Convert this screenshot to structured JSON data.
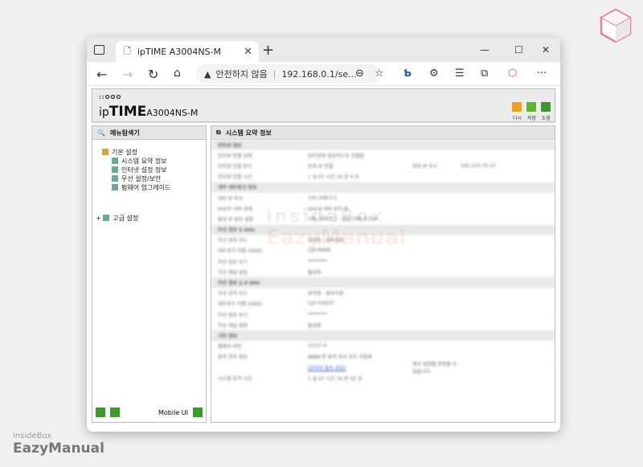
{
  "tab": {
    "title": "ipTIME A3004NS-M"
  },
  "address": {
    "security": "안전하지 않음",
    "url": "192.168.0.1/se..."
  },
  "router": {
    "dots": "::OOO",
    "logo_ip": "ip",
    "logo_time": "TIME",
    "model": "A3004NS-M",
    "buttons": [
      {
        "label": "다시",
        "color": "#f0a020"
      },
      {
        "label": "저장",
        "color": "#5ab82e"
      },
      {
        "label": "도움",
        "color": "#3a9b2a"
      }
    ]
  },
  "menu": {
    "title": "메뉴탐색기",
    "basic": "기본 설정",
    "items": [
      "시스템 요약 정보",
      "인터넷 설정 정보",
      "무선 설정/보안",
      "펌웨어 업그레이드"
    ],
    "advanced": "고급 설정",
    "mobile": "Mobile UI"
  },
  "info": {
    "title": "시스템 요약 정보",
    "rows": [
      {
        "type": "sec",
        "c1": "인터넷 정보"
      },
      {
        "c1": "인터넷 연결 상태",
        "c2": "인터넷에 정상적으로 연결됨"
      },
      {
        "c1": "인터넷 연결 방식",
        "c2": "동적 IP 연결",
        "c3": "외부 IP 주소",
        "c4": "192.215.70.15"
      },
      {
        "c1": "인터넷 연결 시간",
        "c2": "1 일 07 시간 33 분 6 초"
      },
      {
        "type": "sec",
        "c1": "내부 네트워크 정보"
      },
      {
        "c1": "내부 IP 주소",
        "c2": "192.168.0.1"
      },
      {
        "c1": "DHCP 서버 상태",
        "c2": "DHCP 서버 동작 중"
      },
      {
        "c1": "할당 IP 범위 설정",
        "c2": "192.168.0.2 - 192.168.0.254"
      },
      {
        "type": "sec",
        "c1": "무선 정보 5 GHz"
      },
      {
        "c1": "무선 동작 모드",
        "c2": "동작중 - 접속허용"
      },
      {
        "c1": "네트워크 이름 (SSID)",
        "c2": "CJH-MAIN"
      },
      {
        "c1": "무선 암호 보기",
        "c2": "********"
      },
      {
        "c1": "무선 채널 설정",
        "c2": "활성화"
      },
      {
        "type": "sec",
        "c1": "무선 정보 2.4 GHz"
      },
      {
        "c1": "무선 동작 모드",
        "c2": "동작중 - 접속허용"
      },
      {
        "c1": "네트워크 이름 (SSID)",
        "c2": "CJH-GUEST"
      },
      {
        "c1": "무선 암호 보기",
        "c2": "********"
      },
      {
        "c1": "무선 채널 설정",
        "c2": "활성화"
      },
      {
        "type": "sec",
        "c1": "기타 정보"
      },
      {
        "c1": "펌웨어 버전",
        "c2": "10.07.9"
      },
      {
        "c1": "원격 관리 정보",
        "c2": "8888 번 원격 관리 포트 사용중"
      },
      {
        "c1": "",
        "c2": "[관리자 접속 암호]",
        "c3": "에서 설정을 변경할 수 있습니다.",
        "link": true
      },
      {
        "c1": "시스템 동작 시간",
        "c2": "1 일 07 시간 34 분 02 초"
      }
    ]
  },
  "watermark": {
    "line1": "insideBox",
    "line2": "EazyManual"
  },
  "brand": {
    "small": "insideBox",
    "big": "EazyManual"
  }
}
